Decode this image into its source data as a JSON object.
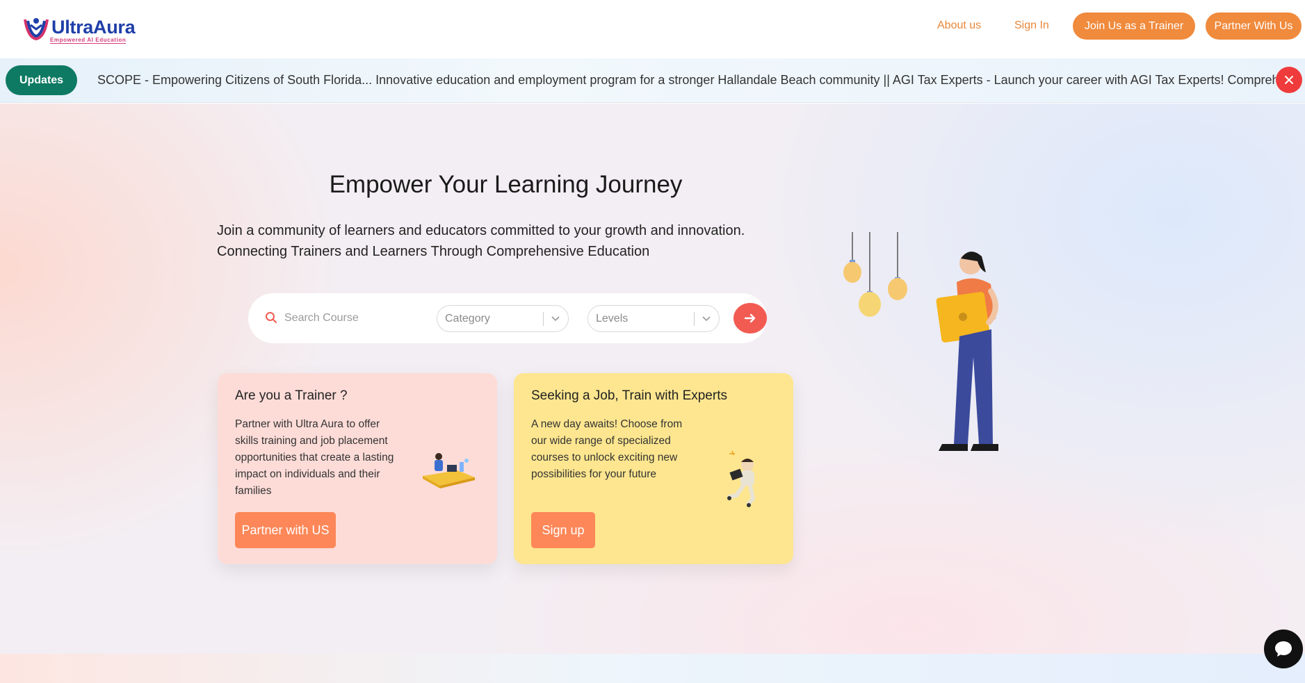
{
  "brand": {
    "name": "UltraAura",
    "tagline": "Empowered AI Education"
  },
  "nav": {
    "about": "About us",
    "sign_in": "Sign In",
    "join_trainer": "Join Us as a Trainer",
    "partner": "Partner With Us"
  },
  "updates": {
    "label": "Updates",
    "ticker": "SCOPE - Empowering Citizens of South Florida... Innovative education and employment program for a stronger Hallandale Beach community || AGI Tax Experts - Launch your career with AGI Tax Experts! Compreh"
  },
  "hero": {
    "title": "Empower Your Learning Journey",
    "subtitle_line1": "Join a community of learners and educators committed to your growth and innovation.",
    "subtitle_line2": "Connecting Trainers and Learners Through Comprehensive Education"
  },
  "search": {
    "placeholder": "Search Course",
    "category": "Category",
    "levels": "Levels"
  },
  "cards": {
    "trainer": {
      "title": "Are you a Trainer ?",
      "text": "Partner with Ultra Aura to offer skills training and job placement opportunities that create a lasting impact on individuals and their families",
      "button": "Partner with US"
    },
    "job": {
      "title": "Seeking a Job, Train with Experts",
      "text": "A new day awaits! Choose from our wide range of specialized courses to unlock exciting new possibilities for your future",
      "button": "Sign up"
    }
  },
  "colors": {
    "accent_orange": "#f08a3c",
    "updates_green": "#0f7a64",
    "close_red": "#ef3b3b",
    "go_red": "#f25b52",
    "trainer_card": "#fddcd8",
    "job_card": "#fde68f",
    "card_button": "#fd8758"
  },
  "icons": {
    "search": "search-icon",
    "chevron": "chevron-down-icon",
    "arrow": "arrow-right-icon",
    "close": "close-icon",
    "chat": "chat-icon"
  }
}
